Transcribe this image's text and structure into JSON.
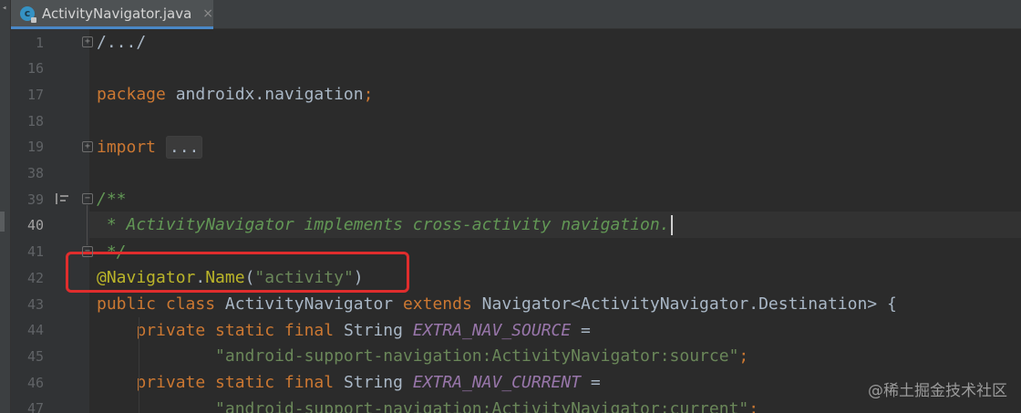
{
  "tab": {
    "title": "ActivityNavigator.java",
    "close": "×",
    "icon": "c"
  },
  "lines": [
    {
      "no": "1",
      "segments": [
        [
          "plain",
          "/.../"
        ]
      ]
    },
    {
      "no": "16",
      "segments": []
    },
    {
      "no": "17",
      "segments": [
        [
          "kw",
          "package"
        ],
        [
          "plain",
          " androidx.navigation"
        ],
        [
          "kw",
          ";"
        ]
      ]
    },
    {
      "no": "18",
      "segments": []
    },
    {
      "no": "19",
      "segments": [
        [
          "kw",
          "import"
        ],
        [
          "plain",
          " "
        ],
        [
          "folded",
          "..."
        ]
      ]
    },
    {
      "no": "38",
      "segments": []
    },
    {
      "no": "39",
      "segments": [
        [
          "doc",
          "/**"
        ]
      ]
    },
    {
      "no": "40",
      "segments": [
        [
          "doc",
          " * ActivityNavigator implements cross-activity navigation."
        ]
      ]
    },
    {
      "no": "41",
      "segments": [
        [
          "doc",
          " */"
        ]
      ]
    },
    {
      "no": "42",
      "segments": [
        [
          "ann",
          "@Navigator"
        ],
        [
          "plain",
          "."
        ],
        [
          "ann",
          "Name"
        ],
        [
          "plain",
          "("
        ],
        [
          "str",
          "\"activity\""
        ],
        [
          "plain",
          ")"
        ]
      ]
    },
    {
      "no": "43",
      "segments": [
        [
          "kw",
          "public class"
        ],
        [
          "plain",
          " ActivityNavigator "
        ],
        [
          "kw",
          "extends"
        ],
        [
          "plain",
          " Navigator<ActivityNavigator.Destination> {"
        ]
      ]
    },
    {
      "no": "44",
      "segments": [
        [
          "plain",
          "    "
        ],
        [
          "kw",
          "private static final"
        ],
        [
          "plain",
          " String "
        ],
        [
          "field",
          "EXTRA_NAV_SOURCE"
        ],
        [
          "plain",
          " ="
        ]
      ]
    },
    {
      "no": "45",
      "segments": [
        [
          "plain",
          "            "
        ],
        [
          "str",
          "\"android-support-navigation:ActivityNavigator:source\""
        ],
        [
          "kw",
          ";"
        ]
      ]
    },
    {
      "no": "46",
      "segments": [
        [
          "plain",
          "    "
        ],
        [
          "kw",
          "private static final"
        ],
        [
          "plain",
          " String "
        ],
        [
          "field",
          "EXTRA_NAV_CURRENT"
        ],
        [
          "plain",
          " ="
        ]
      ]
    },
    {
      "no": "47",
      "segments": [
        [
          "plain",
          "            "
        ],
        [
          "str",
          "\"android-support-navigation:ActivityNavigator:current\""
        ],
        [
          "kw",
          ";"
        ]
      ]
    }
  ],
  "current_line": "40",
  "watermark": "@稀土掘金技术社区",
  "colors": {
    "keyword": "#cc7832",
    "annotation": "#bbb529",
    "string": "#6a8759",
    "doc_comment": "#629755",
    "static_field": "#9876aa",
    "highlight_box": "#e02d2d",
    "tab_underline": "#4a88c7"
  },
  "icons": {
    "tab": "java-class-icon",
    "gutter_doc": "doc-comment-toggle-icon",
    "fold": "fold-toggle-icon"
  }
}
